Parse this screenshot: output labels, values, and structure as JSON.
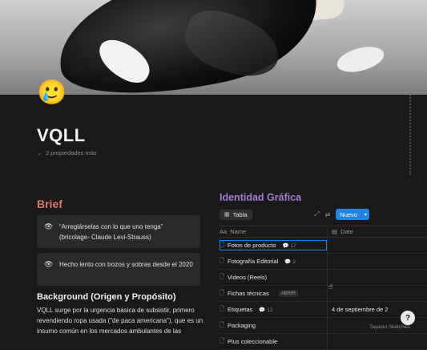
{
  "page": {
    "emoji": "🥲",
    "title": "VQLL",
    "properties_toggle": "3 propiedades más"
  },
  "brief": {
    "title": "Brief",
    "callouts": [
      {
        "icon": "eye-icon",
        "text": "“Arreglárselas con lo que uno tenga” (bricolage- Claude Levi-Strauss)"
      },
      {
        "icon": "eye-icon",
        "text": "Hecho lento con trozos y sobras desde el 2020"
      }
    ],
    "background_title": "Background (Origen y Propósito)",
    "background_text": "VQLL surge por la urgencia básica de subsistir, primero revendiendo ropa usada (\"de paca americana\"), que es un insumo común en los mercados ambulantes de las"
  },
  "identidad": {
    "title": "Identidad Gráfica",
    "view_tab": "Tabla",
    "new_button": "Nuevo",
    "columns": {
      "name": "Name",
      "date": "Date"
    },
    "rows": [
      {
        "name": "Fotos de producto",
        "comments": "17",
        "date": ""
      },
      {
        "name": "Fotografía Editorial",
        "comments": "2",
        "date": ""
      },
      {
        "name": "Videos (Reels)",
        "comments": "",
        "date": ""
      },
      {
        "name": "Fichas técnicas",
        "comments": "",
        "open": "ABRIR",
        "date": ""
      },
      {
        "name": "Etiquetas",
        "comments": "12",
        "date": "4 de septiembre de 2"
      },
      {
        "name": "Packaging",
        "comments": "",
        "date": ""
      },
      {
        "name": "Plus coleccionable",
        "comments": "",
        "date": ""
      }
    ]
  },
  "watermark": "Tayasui Sketches",
  "help": "?"
}
